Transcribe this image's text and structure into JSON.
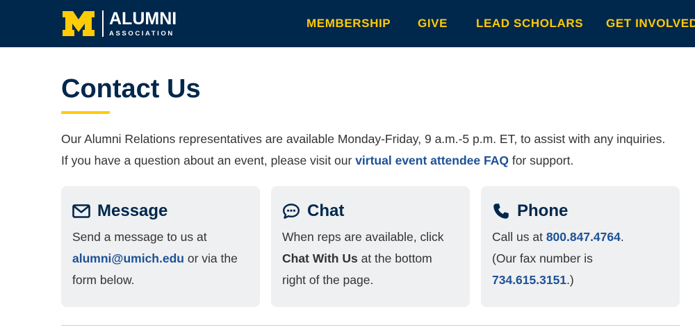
{
  "header": {
    "logo": {
      "word": "ALUMNI",
      "sub": "ASSOCIATION",
      "mark": "block-M"
    },
    "nav": [
      "MEMBERSHIP",
      "GIVE",
      "LEAD SCHOLARS",
      "GET INVOLVED"
    ]
  },
  "page": {
    "title": "Contact Us",
    "intro_line1": "Our Alumni Relations representatives are available Monday-Friday, 9 a.m.-5 p.m. ET, to assist with any inquiries.",
    "intro_line2_pre": "If you have a question about an event, please visit our ",
    "intro_line2_link": "virtual event attendee FAQ",
    "intro_line2_post": " for support."
  },
  "cards": {
    "message": {
      "icon": "envelope-icon",
      "title": "Message",
      "text_pre": "Send a message to us at",
      "email": "alumni@umich.edu",
      "text_post": " or via the form below."
    },
    "chat": {
      "icon": "chat-bubble-icon",
      "title": "Chat",
      "text_pre": "When reps are available, click ",
      "strong": "Chat With Us",
      "text_post": " at the bottom right of the page."
    },
    "phone": {
      "icon": "phone-icon",
      "title": "Phone",
      "text_pre": "Call us at ",
      "phone": "800.847.4764",
      "text_mid": ".",
      "fax_pre": "(Our fax number is ",
      "fax": "734.615.3151",
      "fax_post": ".)"
    }
  },
  "colors": {
    "navy": "#00274c",
    "maize": "#ffcb05",
    "link": "#1d5196",
    "card_bg": "#eff0f1",
    "text": "#333333"
  }
}
